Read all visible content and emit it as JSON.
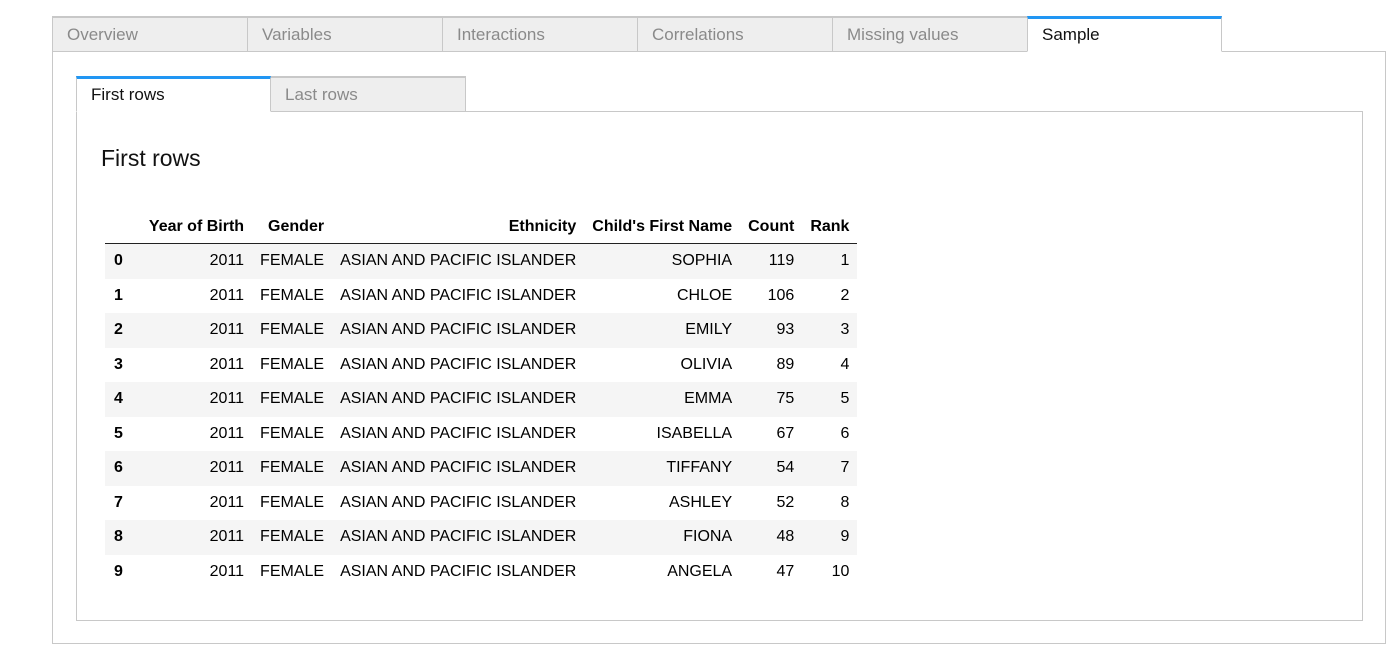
{
  "outer_tabs": [
    {
      "label": "Overview",
      "active": false
    },
    {
      "label": "Variables",
      "active": false
    },
    {
      "label": "Interactions",
      "active": false
    },
    {
      "label": "Correlations",
      "active": false
    },
    {
      "label": "Missing values",
      "active": false
    },
    {
      "label": "Sample",
      "active": true
    }
  ],
  "inner_tabs": [
    {
      "label": "First rows",
      "active": true
    },
    {
      "label": "Last rows",
      "active": false
    }
  ],
  "section_title": "First rows",
  "table": {
    "columns": [
      "",
      "Year of Birth",
      "Gender",
      "Ethnicity",
      "Child's First Name",
      "Count",
      "Rank"
    ],
    "rows": [
      [
        "0",
        "2011",
        "FEMALE",
        "ASIAN AND PACIFIC ISLANDER",
        "SOPHIA",
        "119",
        "1"
      ],
      [
        "1",
        "2011",
        "FEMALE",
        "ASIAN AND PACIFIC ISLANDER",
        "CHLOE",
        "106",
        "2"
      ],
      [
        "2",
        "2011",
        "FEMALE",
        "ASIAN AND PACIFIC ISLANDER",
        "EMILY",
        "93",
        "3"
      ],
      [
        "3",
        "2011",
        "FEMALE",
        "ASIAN AND PACIFIC ISLANDER",
        "OLIVIA",
        "89",
        "4"
      ],
      [
        "4",
        "2011",
        "FEMALE",
        "ASIAN AND PACIFIC ISLANDER",
        "EMMA",
        "75",
        "5"
      ],
      [
        "5",
        "2011",
        "FEMALE",
        "ASIAN AND PACIFIC ISLANDER",
        "ISABELLA",
        "67",
        "6"
      ],
      [
        "6",
        "2011",
        "FEMALE",
        "ASIAN AND PACIFIC ISLANDER",
        "TIFFANY",
        "54",
        "7"
      ],
      [
        "7",
        "2011",
        "FEMALE",
        "ASIAN AND PACIFIC ISLANDER",
        "ASHLEY",
        "52",
        "8"
      ],
      [
        "8",
        "2011",
        "FEMALE",
        "ASIAN AND PACIFIC ISLANDER",
        "FIONA",
        "48",
        "9"
      ],
      [
        "9",
        "2011",
        "FEMALE",
        "ASIAN AND PACIFIC ISLANDER",
        "ANGELA",
        "47",
        "10"
      ]
    ]
  },
  "colors": {
    "accent": "#2196f3",
    "tab_inactive_bg": "#eeeeee",
    "border": "#c8c8c8",
    "row_stripe": "#f5f5f5"
  }
}
